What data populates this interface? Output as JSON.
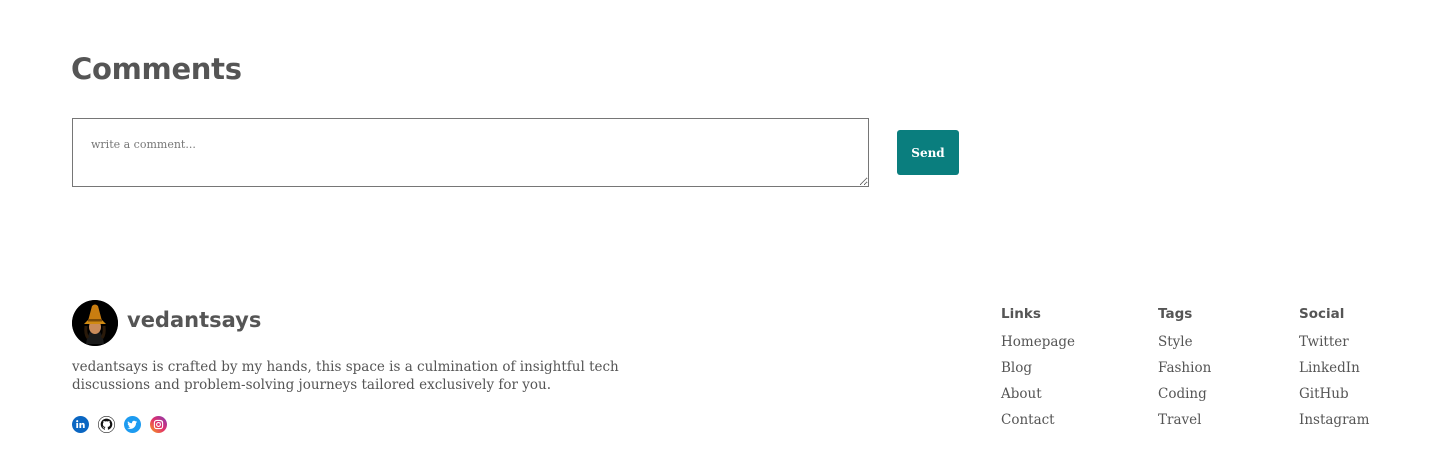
{
  "comments": {
    "title": "Comments",
    "placeholder": "write a comment...",
    "send_label": "Send"
  },
  "footer": {
    "brand": {
      "name": "vedantsays",
      "description": "vedantsays is crafted by my hands, this space is a culmination of insightful tech discussions and problem-solving journeys tailored exclusively for you."
    },
    "social_icons": [
      "linkedin-icon",
      "github-icon",
      "twitter-icon",
      "instagram-icon"
    ],
    "columns": [
      {
        "heading": "Links",
        "items": [
          "Homepage",
          "Blog",
          "About",
          "Contact"
        ]
      },
      {
        "heading": "Tags",
        "items": [
          "Style",
          "Fashion",
          "Coding",
          "Travel"
        ]
      },
      {
        "heading": "Social",
        "items": [
          "Twitter",
          "LinkedIn",
          "GitHub",
          "Instagram"
        ]
      }
    ]
  },
  "colors": {
    "accent": "#0a7e7e",
    "text": "#555555",
    "linkedin": "#0a66c2",
    "twitter": "#1d9bf0",
    "instagram": "#d6249f"
  }
}
